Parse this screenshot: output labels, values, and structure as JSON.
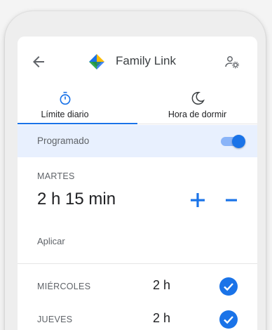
{
  "header": {
    "back_icon": "arrow-back-icon",
    "app_icon": "family-link-logo",
    "title": "Family Link",
    "profile_icon": "manage-accounts-icon"
  },
  "tabs": [
    {
      "label": "Límite diario",
      "icon": "timer-icon",
      "selected": true
    },
    {
      "label": "Hora de dormir",
      "icon": "moon-icon",
      "selected": false
    }
  ],
  "scheduled": {
    "label": "Programado",
    "enabled": true
  },
  "current_day": {
    "name": "MARTES",
    "time": "2 h 15 min",
    "apply_label": "Aplicar"
  },
  "days": [
    {
      "name": "MIÉRCOLES",
      "time": "2 h",
      "checked": true
    },
    {
      "name": "JUEVES",
      "time": "2 h",
      "checked": true
    }
  ],
  "colors": {
    "accent": "#1a73e8",
    "accent_light": "#8ab4f8",
    "scheduled_bg": "#e8f0fe"
  }
}
